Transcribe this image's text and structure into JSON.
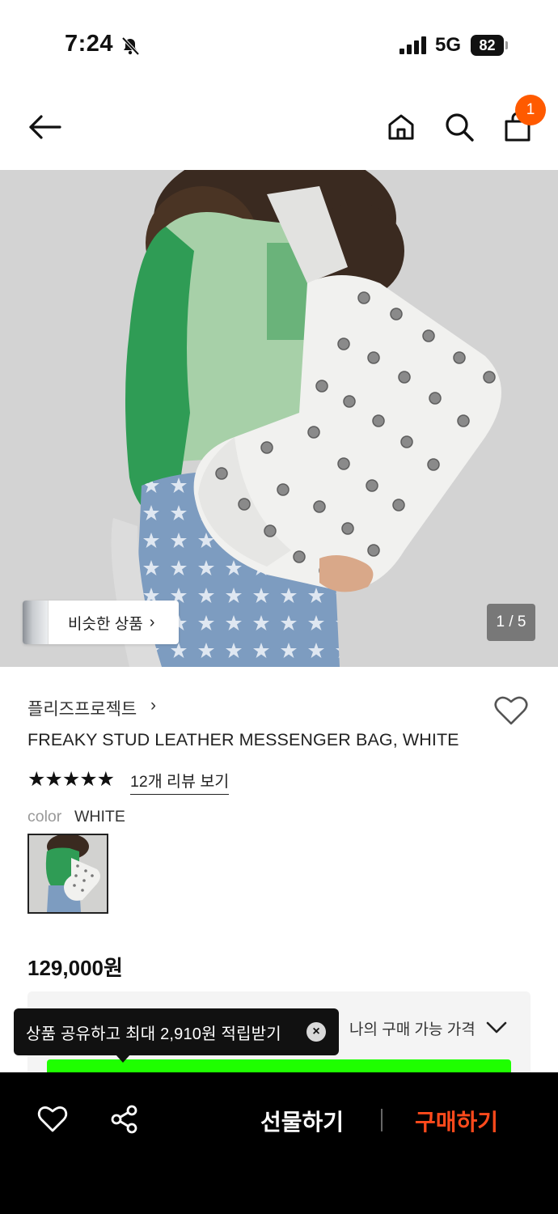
{
  "status_bar": {
    "time": "7:24",
    "network": "5G",
    "battery": "82",
    "icons": [
      "bell-muted-icon",
      "signal-icon",
      "battery-icon"
    ]
  },
  "nav": {
    "icons": [
      "back-arrow-icon",
      "home-icon",
      "search-icon",
      "shopping-bag-icon"
    ],
    "cart_count": "1"
  },
  "gallery": {
    "similar_label": "비슷한 상품",
    "similar_chevron": "›",
    "page_indicator": "1 / 5"
  },
  "product": {
    "brand": "플리즈프로젝트",
    "brand_chevron": "›",
    "title": "FREAKY STUD LEATHER MESSENGER BAG, WHITE",
    "stars": "★★★★★",
    "rating": 5,
    "reviews_link": "12개 리뷰 보기",
    "color_key": "color",
    "color_value": "WHITE",
    "price": "129,000원"
  },
  "price_panel": {
    "my_price_label": "나의 구매 가능 가격"
  },
  "toast": {
    "text": "상품 공유하고 최대 2,910원 적립받기",
    "close_glyph": "×"
  },
  "bottom_bar": {
    "gift_label": "선물하기",
    "buy_label": "구매하기"
  },
  "colors": {
    "accent": "#ff5a00",
    "buy": "#ff4a1c",
    "highlight_bar": "#1fff00"
  }
}
